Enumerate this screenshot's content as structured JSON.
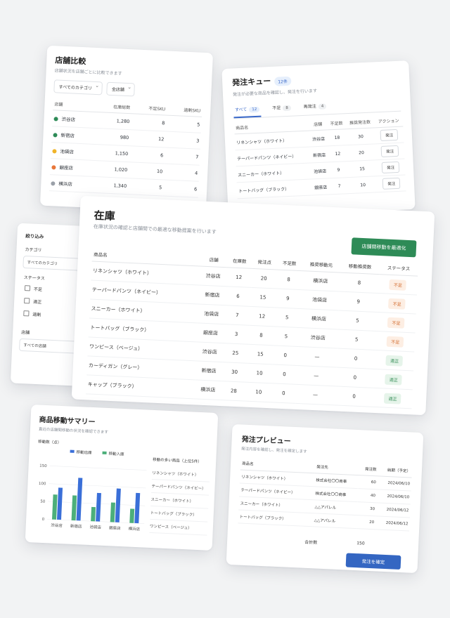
{
  "store_compare": {
    "title": "店舗比較",
    "subtitle": "店舗状況を店舗ごとに比較できます",
    "category_filter": "すべてのカテゴリ",
    "store_filter": "全店舗",
    "columns": [
      "店舗",
      "在庫総数",
      "不足SKU",
      "過剰SKU"
    ],
    "rows": [
      {
        "store": "渋谷店",
        "total": "1,280",
        "short": "8",
        "excess": "5",
        "color": "#2e8b57"
      },
      {
        "store": "新宿店",
        "total": "980",
        "short": "12",
        "excess": "3",
        "color": "#2e8b57"
      },
      {
        "store": "池袋店",
        "total": "1,150",
        "short": "6",
        "excess": "7",
        "color": "#f0b429"
      },
      {
        "store": "銀座店",
        "total": "1,020",
        "short": "10",
        "excess": "4",
        "color": "#e8773a"
      },
      {
        "store": "横浜店",
        "total": "1,340",
        "short": "5",
        "excess": "6",
        "color": "#9aa0a8"
      }
    ]
  },
  "order_queue": {
    "title": "発注キュー",
    "badge": "12件",
    "subtitle": "発注が必要な商品を確認し、発注を行います",
    "tabs": [
      {
        "label": "すべて",
        "count": "12"
      },
      {
        "label": "不足",
        "count": "8"
      },
      {
        "label": "再発注",
        "count": "4"
      }
    ],
    "columns": [
      "商品名",
      "店舗",
      "不足数",
      "推奨発注数",
      "アクション"
    ],
    "rows": [
      {
        "name": "リネンシャツ（ホワイト）",
        "store": "渋谷店",
        "short": "18",
        "rec": "30",
        "action": "発注"
      },
      {
        "name": "テーパードパンツ（ネイビー）",
        "store": "新宿店",
        "short": "12",
        "rec": "20",
        "action": "発注"
      },
      {
        "name": "スニーカー（ホワイト）",
        "store": "池袋店",
        "short": "9",
        "rec": "15",
        "action": "発注"
      },
      {
        "name": "トートバッグ（ブラック）",
        "store": "銀座店",
        "short": "7",
        "rec": "10",
        "action": "発注"
      }
    ]
  },
  "filter": {
    "title": "絞り込み",
    "category_label": "カテゴリ",
    "category_value": "すべてのカテゴリ",
    "status_label": "ステータス",
    "statuses": [
      "不足",
      "適正",
      "過剰"
    ],
    "store_label": "店舗",
    "store_value": "すべての店舗"
  },
  "inventory": {
    "title": "在庫",
    "subtitle": "在庫状況の確認と店舗間での最適な移動提案を行います",
    "optimize_button": "店舗間移動を最適化",
    "columns": [
      "商品名",
      "店舗",
      "在庫数",
      "発注点",
      "不足数",
      "推奨移動元",
      "移動推奨数",
      "ステータス"
    ],
    "rows": [
      {
        "name": "リネンシャツ（ホワイト）",
        "store": "渋谷店",
        "stock": "12",
        "reorder": "20",
        "short": "8",
        "source": "横浜店",
        "move": "8",
        "status": "不足"
      },
      {
        "name": "テーパードパンツ（ネイビー）",
        "store": "新宿店",
        "stock": "6",
        "reorder": "15",
        "short": "9",
        "source": "池袋店",
        "move": "9",
        "status": "不足"
      },
      {
        "name": "スニーカー（ホワイト）",
        "store": "池袋店",
        "stock": "7",
        "reorder": "12",
        "short": "5",
        "source": "横浜店",
        "move": "5",
        "status": "不足"
      },
      {
        "name": "トートバッグ（ブラック）",
        "store": "銀座店",
        "stock": "3",
        "reorder": "8",
        "short": "5",
        "source": "渋谷店",
        "move": "5",
        "status": "不足"
      },
      {
        "name": "ワンピース（ベージュ）",
        "store": "渋谷店",
        "stock": "25",
        "reorder": "15",
        "short": "0",
        "source": "—",
        "move": "0",
        "status": "適正"
      },
      {
        "name": "カーディガン（グレー）",
        "store": "新宿店",
        "stock": "30",
        "reorder": "10",
        "short": "0",
        "source": "—",
        "move": "0",
        "status": "適正"
      },
      {
        "name": "キャップ（ブラック）",
        "store": "横浜店",
        "stock": "28",
        "reorder": "10",
        "short": "0",
        "source": "—",
        "move": "0",
        "status": "適正"
      }
    ]
  },
  "move_summary": {
    "title": "商品移動サマリー",
    "subtitle": "直近の店舗間移動の状況を確認できます",
    "y_label": "移動数（点）",
    "top_items_title": "移動の多い商品（上位5件）",
    "top_items": [
      "リネンシャツ（ホワイト）",
      "テーパードパンツ（ネイビー）",
      "スニーカー（ホワイト）",
      "トートバッグ（ブラック）",
      "ワンピース（ベージュ）"
    ],
    "chart_data": {
      "type": "bar",
      "categories": [
        "渋谷店",
        "新宿店",
        "池袋店",
        "銀座店",
        "横浜店"
      ],
      "series": [
        {
          "name": "移動出庫",
          "color": "#3a6fd8",
          "values": [
            90,
            120,
            80,
            95,
            85
          ]
        },
        {
          "name": "移動入庫",
          "color": "#4caf7a",
          "values": [
            70,
            70,
            40,
            55,
            40
          ]
        }
      ],
      "ylim": [
        0,
        150
      ],
      "yticks": [
        "0",
        "50",
        "100",
        "150"
      ],
      "legend": "top"
    }
  },
  "order_preview": {
    "title": "発注プレビュー",
    "subtitle": "発注内容を確認し、発注を確定します",
    "columns": [
      "商品名",
      "発注先",
      "発注数",
      "納期（予定）"
    ],
    "rows": [
      {
        "name": "リネンシャツ（ホワイト）",
        "vendor": "株式会社〇〇商事",
        "qty": "60",
        "date": "2024/06/10"
      },
      {
        "name": "テーパードパンツ（ネイビー）",
        "vendor": "株式会社〇〇商事",
        "qty": "40",
        "date": "2024/06/10"
      },
      {
        "name": "スニーカー（ホワイト）",
        "vendor": "△△アパレル",
        "qty": "30",
        "date": "2024/06/12"
      },
      {
        "name": "トートバッグ（ブラック）",
        "vendor": "△△アパレル",
        "qty": "20",
        "date": "2024/06/12"
      }
    ],
    "total_label": "合計数",
    "total_value": "150",
    "confirm_button": "発注を確定"
  }
}
